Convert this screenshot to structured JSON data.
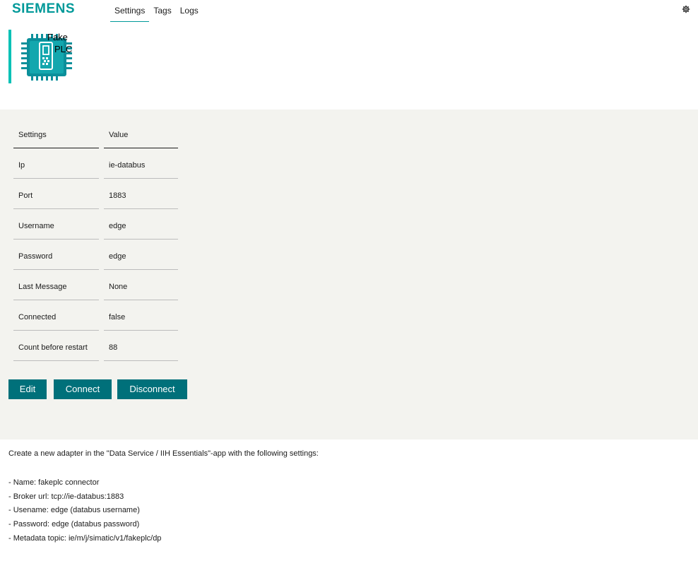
{
  "header": {
    "brand": "SIEMENS",
    "tabs": [
      {
        "label": "Settings",
        "active": true
      },
      {
        "label": "Tags",
        "active": false
      },
      {
        "label": "Logs",
        "active": false
      }
    ],
    "settings_icon": "gear-icon"
  },
  "app": {
    "title_line1": "Fake",
    "title_line2": "PLC",
    "icon": "plc-chip-icon"
  },
  "settings_table": {
    "headers": {
      "name": "Settings",
      "value": "Value"
    },
    "rows": [
      {
        "name": "Ip",
        "value": "ie-databus"
      },
      {
        "name": "Port",
        "value": "1883"
      },
      {
        "name": "Username",
        "value": "edge"
      },
      {
        "name": "Password",
        "value": "edge"
      },
      {
        "name": "Last Message",
        "value": "None"
      },
      {
        "name": "Connected",
        "value": "false"
      },
      {
        "name": "Count before restart",
        "value": "88"
      }
    ]
  },
  "buttons": {
    "edit": "Edit",
    "connect": "Connect",
    "disconnect": "Disconnect"
  },
  "instructions": {
    "intro": "Create a new adapter in the \"Data Service / IIH Essentials\"-app with the following settings:",
    "items": [
      "- Name: fakeplc connector",
      "- Broker url: tcp://ie-databus:1883",
      "- Usename: edge (databus username)",
      "- Password: edge (databus password)",
      "- Metadata topic: ie/m/j/simatic/v1/fakeplc/dp"
    ]
  },
  "colors": {
    "brand": "#009999",
    "button": "#00707a",
    "accent_bar": "#00c1b6",
    "panel": "#f3f3ef"
  }
}
